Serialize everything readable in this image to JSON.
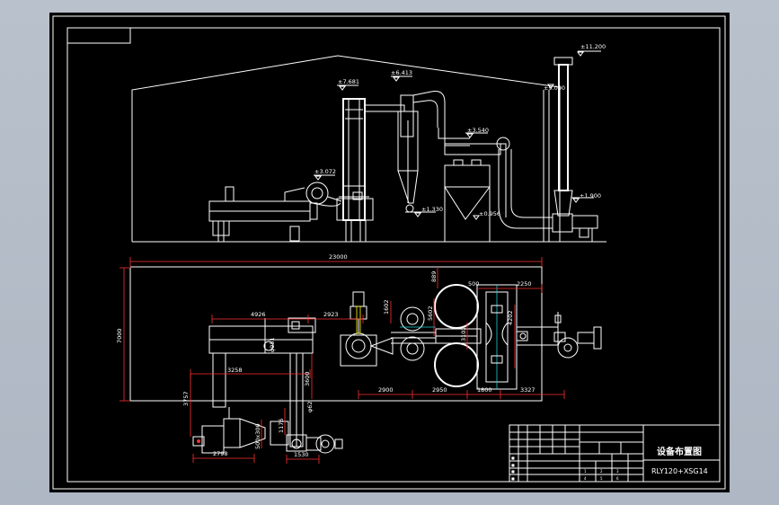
{
  "drawing": {
    "title": "设备布置图",
    "model": "RLY120+XSG14",
    "colors": {
      "background": "#000000",
      "line": "#ffffff",
      "dimension": "#ff3030",
      "frame": "#b9c1cc"
    }
  },
  "elevations": {
    "e11200": "±11.200",
    "e7681": "±7.681",
    "e6413": "±6.413",
    "e3540": "±3.540",
    "e3072": "±3.072",
    "e1330": "±1.330",
    "e1900": "±1.900",
    "e0956": "±0.956",
    "e9000": "±9.000"
  },
  "dimensions": {
    "d23000": "23000",
    "d7000": "7000",
    "d4926": "4926",
    "d2923": "2923",
    "d1602": "1602",
    "d5602": "5602",
    "d889": "889",
    "d500": "500",
    "d2250": "2250",
    "d4202": "4202",
    "d3102": "3102",
    "d3258": "3258",
    "d3600": "3600",
    "d3757": "3757",
    "d2900": "2900",
    "d2950": "2950",
    "d1800": "1800",
    "d3327": "3327",
    "d2798": "2798",
    "d1530": "1530",
    "d1176": "1176",
    "d500x300": "500x300",
    "d6951": "φ951",
    "d62": "φ62"
  },
  "title_block": {
    "sheet_codes": [
      "1",
      "2",
      "3",
      "4",
      "5",
      "6"
    ]
  }
}
